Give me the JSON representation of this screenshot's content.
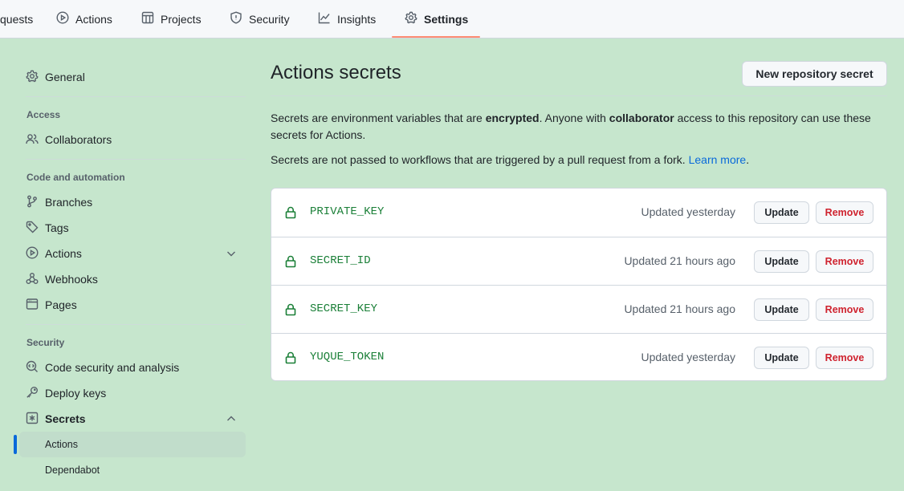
{
  "topnav": {
    "tabs": [
      {
        "label": "quests",
        "icon": "pull-request-icon"
      },
      {
        "label": "Actions",
        "icon": "play-icon"
      },
      {
        "label": "Projects",
        "icon": "table-icon"
      },
      {
        "label": "Security",
        "icon": "shield-icon"
      },
      {
        "label": "Insights",
        "icon": "graph-icon"
      },
      {
        "label": "Settings",
        "icon": "gear-icon",
        "active": true
      }
    ]
  },
  "sidebar": {
    "general": "General",
    "access_heading": "Access",
    "collaborators": "Collaborators",
    "code_heading": "Code and automation",
    "branches": "Branches",
    "tags": "Tags",
    "actions": "Actions",
    "webhooks": "Webhooks",
    "pages": "Pages",
    "security_heading": "Security",
    "code_security": "Code security and analysis",
    "deploy_keys": "Deploy keys",
    "secrets": "Secrets",
    "secrets_actions": "Actions",
    "secrets_dependabot": "Dependabot"
  },
  "main": {
    "title": "Actions secrets",
    "new_button": "New repository secret",
    "desc1_a": "Secrets are environment variables that are ",
    "desc1_b": "encrypted",
    "desc1_c": ". Anyone with ",
    "desc1_d": "collaborator",
    "desc1_e": " access to this repository can use these secrets for Actions.",
    "desc2_a": "Secrets are not passed to workflows that are triggered by a pull request from a fork. ",
    "desc2_link": "Learn more",
    "desc2_end": ".",
    "update_label": "Update",
    "remove_label": "Remove",
    "secrets": [
      {
        "name": "PRIVATE_KEY",
        "updated": "Updated yesterday"
      },
      {
        "name": "SECRET_ID",
        "updated": "Updated 21 hours ago"
      },
      {
        "name": "SECRET_KEY",
        "updated": "Updated 21 hours ago"
      },
      {
        "name": "YUQUE_TOKEN",
        "updated": "Updated yesterday"
      }
    ]
  },
  "colors": {
    "background": "#c6e6cd",
    "accent": "#0969da",
    "secret_green": "#1a7f37",
    "danger": "#cf222e",
    "tab_underline": "#fd8c73"
  }
}
